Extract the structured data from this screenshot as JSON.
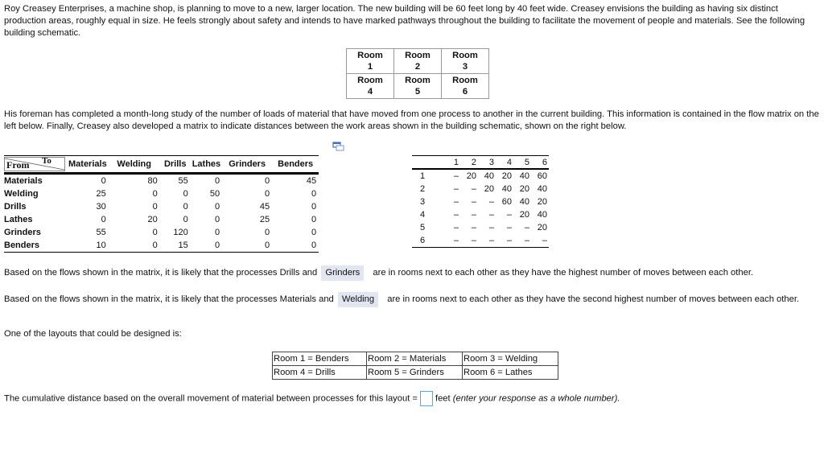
{
  "intro": "Roy Creasey Enterprises, a machine shop, is planning to move to a new, larger location. The new building will be 60 feet long by 40 feet wide. Creasey envisions the building as having six distinct production areas, roughly equal in size. He feels strongly about safety and intends to have marked pathways throughout the building to facilitate the movement of people and materials. See the following building schematic.",
  "schematic": {
    "rooms": [
      [
        "Room",
        "1"
      ],
      [
        "Room",
        "2"
      ],
      [
        "Room",
        "3"
      ],
      [
        "Room",
        "4"
      ],
      [
        "Room",
        "5"
      ],
      [
        "Room",
        "6"
      ]
    ]
  },
  "foreman": "His foreman has completed a month-long study of the number of loads of material that have moved from one process to another in the current building. This information is contained in the flow matrix on the left below. Finally, Creasey also developed a matrix to indicate distances between the work areas shown in the building schematic, shown on the right below.",
  "popout_icon": "popout-window-icon",
  "flow_matrix": {
    "corner_from": "From",
    "corner_to": "To",
    "columns": [
      "Materials",
      "Welding",
      "Drills",
      "Lathes",
      "Grinders",
      "Benders"
    ],
    "rows": [
      {
        "label": "Materials",
        "values": [
          "0",
          "80",
          "55",
          "0",
          "0",
          "45"
        ]
      },
      {
        "label": "Welding",
        "values": [
          "25",
          "0",
          "0",
          "50",
          "0",
          "0"
        ]
      },
      {
        "label": "Drills",
        "values": [
          "30",
          "0",
          "0",
          "0",
          "45",
          "0"
        ]
      },
      {
        "label": "Lathes",
        "values": [
          "0",
          "20",
          "0",
          "0",
          "25",
          "0"
        ]
      },
      {
        "label": "Grinders",
        "values": [
          "55",
          "0",
          "120",
          "0",
          "0",
          "0"
        ]
      },
      {
        "label": "Benders",
        "values": [
          "10",
          "0",
          "15",
          "0",
          "0",
          "0"
        ]
      }
    ]
  },
  "distance_matrix": {
    "columns": [
      "1",
      "2",
      "3",
      "4",
      "5",
      "6"
    ],
    "rows": [
      {
        "label": "1",
        "values": [
          "–",
          "20",
          "40",
          "20",
          "40",
          "60"
        ]
      },
      {
        "label": "2",
        "values": [
          "–",
          "–",
          "20",
          "40",
          "20",
          "40"
        ]
      },
      {
        "label": "3",
        "values": [
          "–",
          "–",
          "–",
          "60",
          "40",
          "20"
        ]
      },
      {
        "label": "4",
        "values": [
          "–",
          "–",
          "–",
          "–",
          "20",
          "40"
        ]
      },
      {
        "label": "5",
        "values": [
          "–",
          "–",
          "–",
          "–",
          "–",
          "20"
        ]
      },
      {
        "label": "6",
        "values": [
          "–",
          "–",
          "–",
          "–",
          "–",
          "–"
        ]
      }
    ]
  },
  "q1": {
    "before": "Based on the flows shown in the matrix, it is likely that the processes Drills and",
    "answer": "Grinders",
    "after": "are in rooms next to each other as they have the highest number of moves between each other."
  },
  "q2": {
    "before": "Based on the flows shown in the matrix, it is likely that the processes Materials and",
    "answer": "Welding",
    "after": "are in rooms next to each other as they have the second highest number of moves between each other."
  },
  "layout_intro": "One of the layouts that could be designed is:",
  "layout": {
    "cells": [
      [
        "Room 1 = Benders",
        "Room 2 = Materials",
        "Room 3 = Welding"
      ],
      [
        "Room 4 = Drills",
        "Room 5 = Grinders",
        "Room 6 = Lathes"
      ]
    ]
  },
  "final": {
    "before": "The cumulative distance based on the overall movement of material between processes for this layout =",
    "input_value": "",
    "unit": "feet",
    "hint": "(enter your response as a whole number)."
  }
}
